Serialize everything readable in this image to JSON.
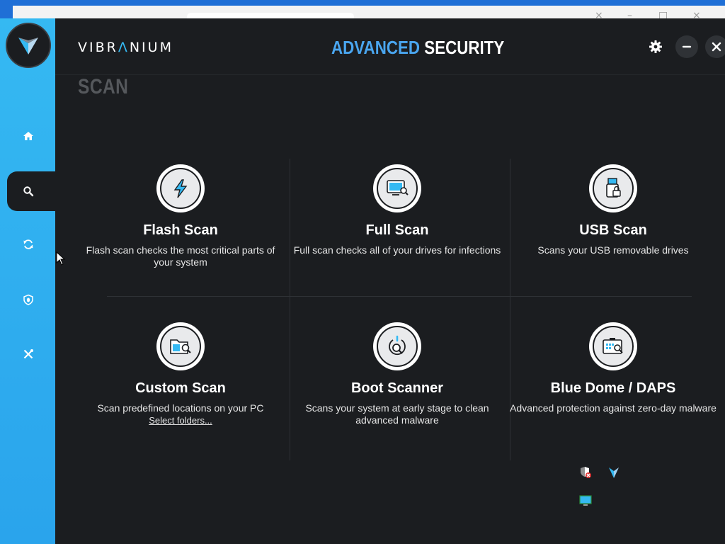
{
  "header": {
    "brand_prefix": "VIBR",
    "brand_accent": "Λ",
    "brand_suffix": "NIUM",
    "title_part1": "ADVANCED",
    "title_part2": "SECURITY"
  },
  "section": {
    "title": "SCAN"
  },
  "sidebar": {
    "items": [
      {
        "icon": "home-icon"
      },
      {
        "icon": "search-icon",
        "active": true
      },
      {
        "icon": "refresh-icon"
      },
      {
        "icon": "shield-bug-icon"
      },
      {
        "icon": "tools-icon"
      }
    ]
  },
  "cards": [
    {
      "title": "Flash Scan",
      "desc": "Flash scan checks the most critical parts of your system",
      "icon": "lightning-icon"
    },
    {
      "title": "Full Scan",
      "desc": "Full scan checks all of your drives for infections",
      "icon": "monitor-search-icon"
    },
    {
      "title": "USB Scan",
      "desc": "Scans your USB removable drives",
      "icon": "usb-lock-icon"
    },
    {
      "title": "Custom Scan",
      "desc": "Scan predefined locations on your PC",
      "link": "Select folders...",
      "icon": "folder-search-icon"
    },
    {
      "title": "Boot Scanner",
      "desc": "Scans your system at early stage to clean advanced malware",
      "icon": "boot-scan-icon"
    },
    {
      "title": "Blue Dome / DAPS",
      "desc": "Advanced protection against zero-day malware",
      "icon": "keyboard-search-icon"
    }
  ],
  "colors": {
    "accent": "#35b9f2",
    "title_blue": "#4aa6f0",
    "background": "#1b1d20",
    "sidebar": "#2aa4ec"
  }
}
